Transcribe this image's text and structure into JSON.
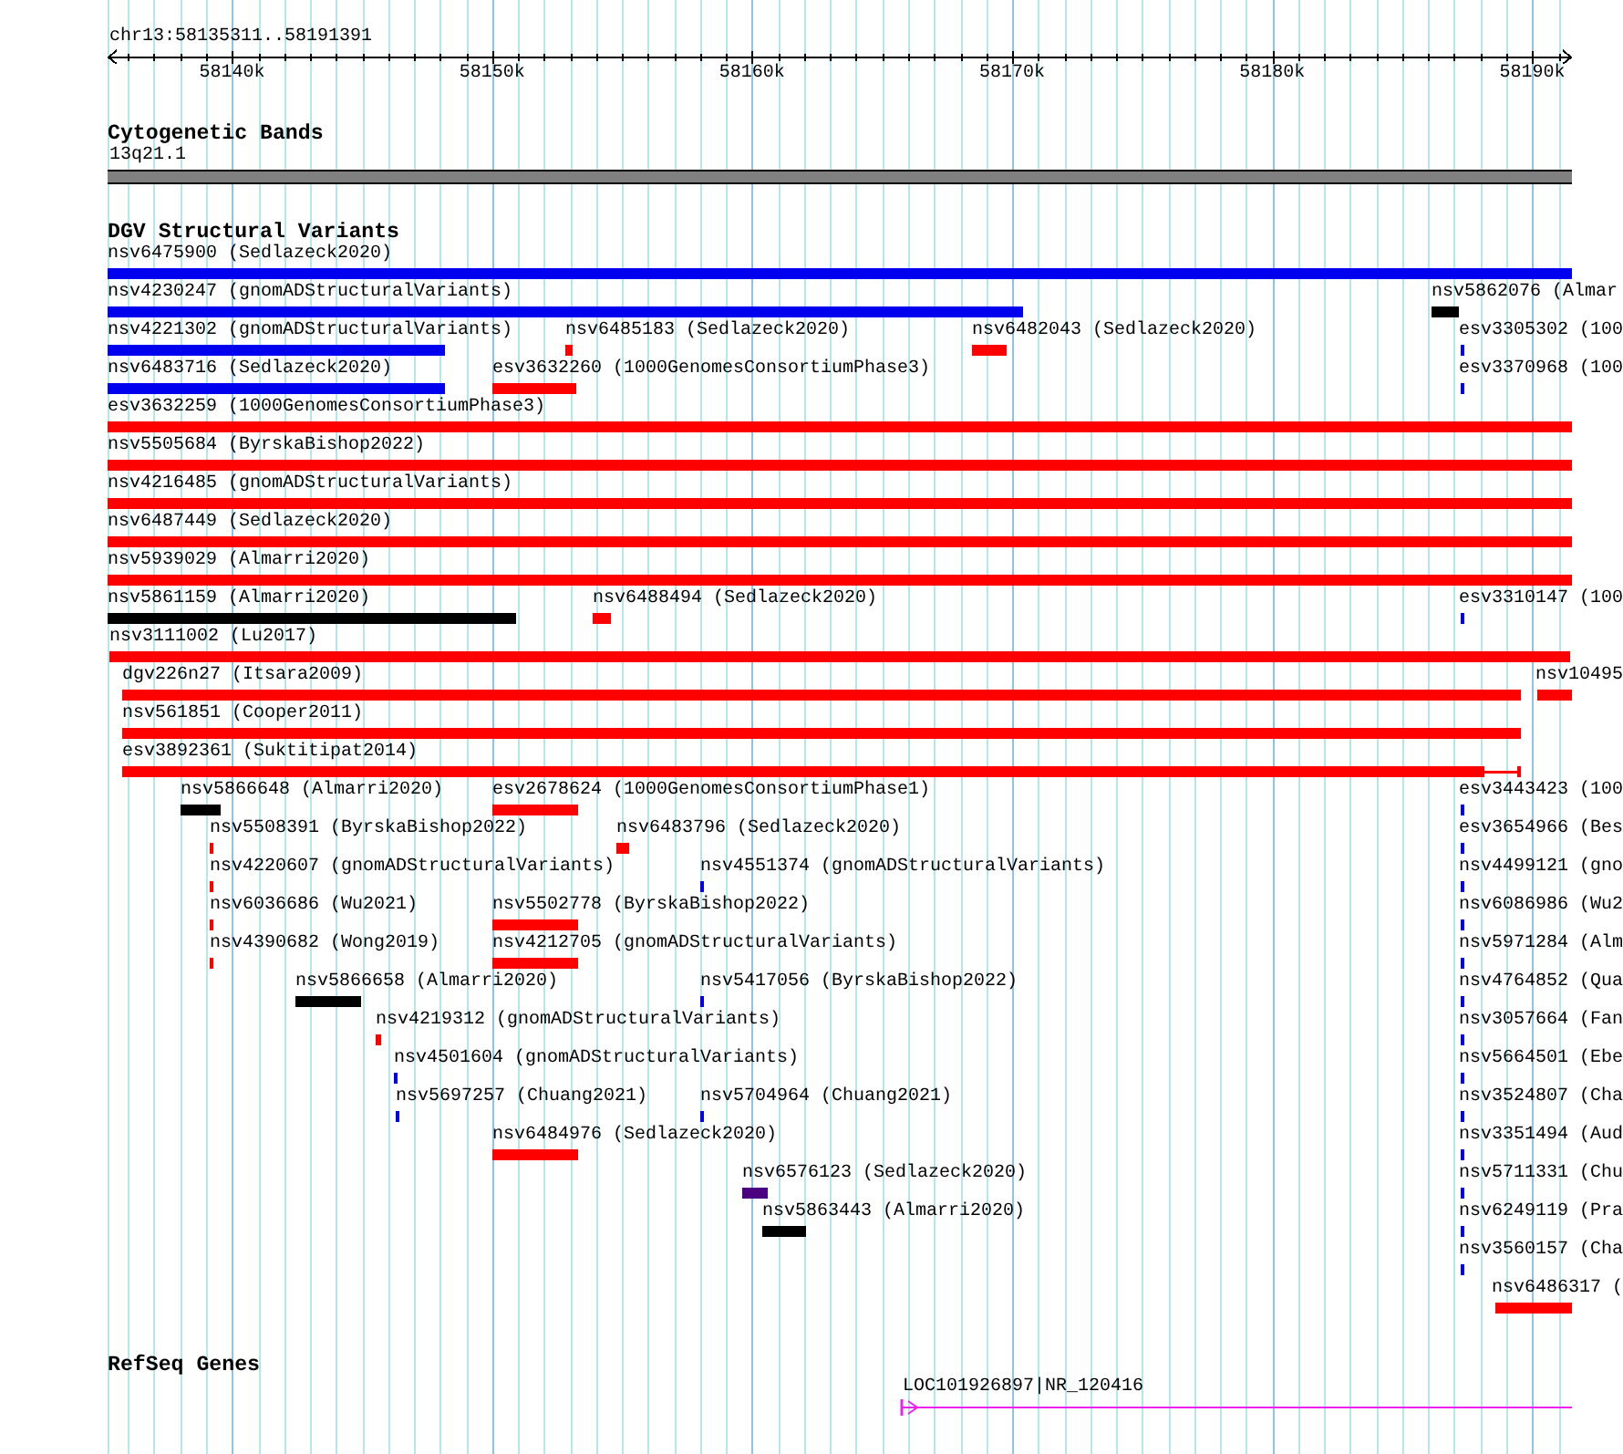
{
  "ruler": {
    "location": "chr13:58135311..58191391",
    "ticks": [
      "58140k",
      "58150k",
      "58160k",
      "58170k",
      "58180k",
      "58190k"
    ]
  },
  "tracks": [
    {
      "kind": "cytoband",
      "title": "Cytogenetic Bands",
      "bands": [
        {
          "label": "13q21.1"
        }
      ]
    },
    {
      "kind": "variants",
      "title": "DGV Structural Variants",
      "rows": [
        [
          {
            "label": "nsv6475900 (Sedlazeck2020)",
            "color": "#0000ee"
          }
        ],
        [
          {
            "label": "nsv4230247 (gnomADStructuralVariants)",
            "color": "#0000ee"
          },
          {
            "label": "nsv5862076 (Almar",
            "color": "#000000"
          }
        ],
        [
          {
            "label": "nsv4221302 (gnomADStructuralVariants)",
            "color": "#0000ee"
          },
          {
            "label": "nsv6485183 (Sedlazeck2020)",
            "color": "#ff0000"
          },
          {
            "label": "nsv6482043 (Sedlazeck2020)",
            "color": "#ff0000"
          },
          {
            "label": "esv3305302 (100",
            "color": "#0000ee"
          }
        ],
        [
          {
            "label": "nsv6483716 (Sedlazeck2020)",
            "color": "#0000ee"
          },
          {
            "label": "esv3632260 (1000GenomesConsortiumPhase3)",
            "color": "#ff0000"
          },
          {
            "label": "esv3370968 (100",
            "color": "#0000ee"
          }
        ],
        [
          {
            "label": "esv3632259 (1000GenomesConsortiumPhase3)",
            "color": "#ff0000"
          }
        ],
        [
          {
            "label": "nsv5505684 (ByrskaBishop2022)",
            "color": "#ff0000"
          }
        ],
        [
          {
            "label": "nsv4216485 (gnomADStructuralVariants)",
            "color": "#ff0000"
          }
        ],
        [
          {
            "label": "nsv6487449 (Sedlazeck2020)",
            "color": "#ff0000"
          }
        ],
        [
          {
            "label": "nsv5939029 (Almarri2020)",
            "color": "#ff0000"
          }
        ],
        [
          {
            "label": "nsv5861159 (Almarri2020)",
            "color": "#000000"
          },
          {
            "label": "nsv6488494 (Sedlazeck2020)",
            "color": "#ff0000"
          },
          {
            "label": "esv3310147 (100",
            "color": "#0000ee"
          }
        ],
        [
          {
            "label": "nsv3111002 (Lu2017)",
            "color": "#ff0000"
          }
        ],
        [
          {
            "label": "dgv226n27 (Itsara2009)",
            "color": "#ff0000"
          },
          {
            "label": "nsv10495",
            "color": "#ff0000"
          }
        ],
        [
          {
            "label": "nsv561851 (Cooper2011)",
            "color": "#ff0000"
          }
        ],
        [
          {
            "label": "esv3892361 (Suktitipat2014)",
            "color": "#ff0000"
          }
        ],
        [
          {
            "label": "nsv5866648 (Almarri2020)",
            "color": "#000000"
          },
          {
            "label": "esv2678624 (1000GenomesConsortiumPhase1)",
            "color": "#ff0000"
          },
          {
            "label": "esv3443423 (100",
            "color": "#0000ee"
          }
        ],
        [
          {
            "label": "nsv5508391 (ByrskaBishop2022)",
            "color": "#ff0000"
          },
          {
            "label": "nsv6483796 (Sedlazeck2020)",
            "color": "#ff0000"
          },
          {
            "label": "esv3654966 (Bes",
            "color": "#0000ee"
          }
        ],
        [
          {
            "label": "nsv4220607 (gnomADStructuralVariants)",
            "color": "#ff0000"
          },
          {
            "label": "nsv4551374 (gnomADStructuralVariants)",
            "color": "#0000ee"
          },
          {
            "label": "nsv4499121 (gno",
            "color": "#0000ee"
          }
        ],
        [
          {
            "label": "nsv6036686 (Wu2021)",
            "color": "#ff0000"
          },
          {
            "label": "nsv5502778 (ByrskaBishop2022)",
            "color": "#ff0000"
          },
          {
            "label": "nsv6086986 (Wu2",
            "color": "#0000ee"
          }
        ],
        [
          {
            "label": "nsv4390682 (Wong2019)",
            "color": "#ff0000"
          },
          {
            "label": "nsv4212705 (gnomADStructuralVariants)",
            "color": "#ff0000"
          },
          {
            "label": "nsv5971284 (Alm",
            "color": "#0000ee"
          }
        ],
        [
          {
            "label": "nsv5866658 (Almarri2020)",
            "color": "#000000"
          },
          {
            "label": "nsv5417056 (ByrskaBishop2022)",
            "color": "#0000ee"
          },
          {
            "label": "nsv4764852 (Qua",
            "color": "#0000ee"
          }
        ],
        [
          {
            "label": "nsv4219312 (gnomADStructuralVariants)",
            "color": "#ff0000"
          },
          {
            "label": "nsv3057664 (Fan",
            "color": "#0000ee"
          }
        ],
        [
          {
            "label": "nsv4501604 (gnomADStructuralVariants)",
            "color": "#0000ee"
          },
          {
            "label": "nsv5664501 (Ebe",
            "color": "#0000ee"
          }
        ],
        [
          {
            "label": "nsv5697257 (Chuang2021)",
            "color": "#0000ee"
          },
          {
            "label": "nsv5704964 (Chuang2021)",
            "color": "#0000ee"
          },
          {
            "label": "nsv3524807 (Cha",
            "color": "#0000ee"
          }
        ],
        [
          {
            "label": "nsv6484976 (Sedlazeck2020)",
            "color": "#ff0000"
          },
          {
            "label": "nsv3351494 (Aud",
            "color": "#0000ee"
          }
        ],
        [
          {
            "label": "nsv6576123 (Sedlazeck2020)",
            "color": "#4b0082"
          },
          {
            "label": "nsv5711331 (Chu",
            "color": "#0000ee"
          }
        ],
        [
          {
            "label": "nsv5863443 (Almarri2020)",
            "color": "#000000"
          },
          {
            "label": "nsv6249119 (Pra",
            "color": "#0000ee"
          }
        ],
        [
          {
            "label": "nsv3560157 (Cha",
            "color": "#0000ee"
          }
        ],
        [
          {
            "label": "nsv6486317 (",
            "color": "#ff0000"
          }
        ]
      ]
    },
    {
      "kind": "genes",
      "title": "RefSeq Genes",
      "genes": [
        {
          "label": "LOC101926897|NR_120416"
        }
      ]
    }
  ]
}
